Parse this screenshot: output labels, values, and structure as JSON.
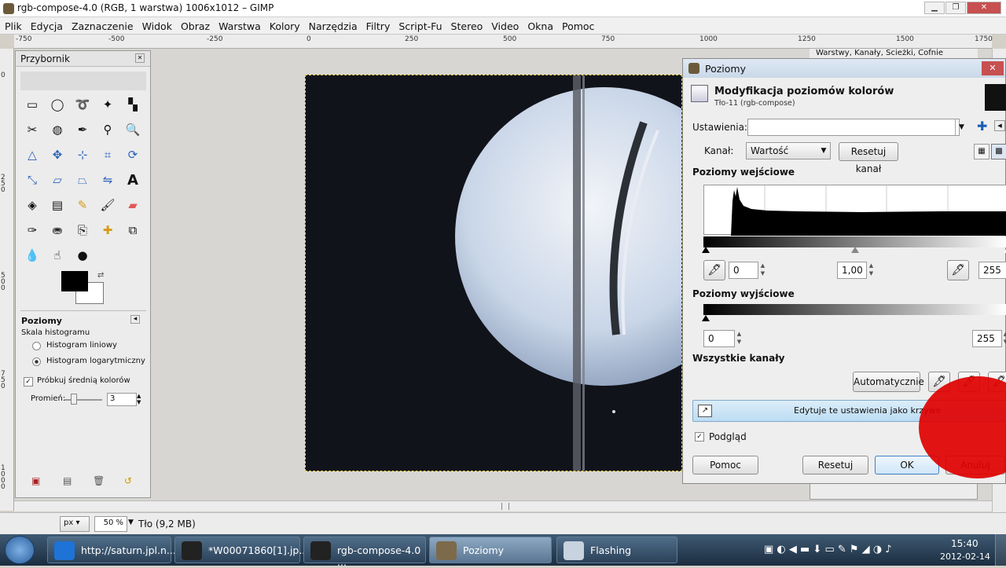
{
  "window": {
    "title": "rgb-compose-4.0 (RGB, 1 warstwa) 1006x1012 – GIMP"
  },
  "menu": [
    "Plik",
    "Edycja",
    "Zaznaczenie",
    "Widok",
    "Obraz",
    "Warstwa",
    "Kolory",
    "Narzędzia",
    "Filtry",
    "Script-Fu",
    "Stereo",
    "Video",
    "Okna",
    "Pomoc"
  ],
  "ruler": {
    "h_labels": [
      "-750",
      "-500",
      "-250",
      "0",
      "250",
      "500",
      "750",
      "1000",
      "1250",
      "1500",
      "1750"
    ],
    "v_labels": [
      "0",
      "250",
      "500",
      "750",
      "1000"
    ]
  },
  "layers_dock_text": "Warstwy, Kanały, Ścieżki, Cofnie",
  "toolbox": {
    "title": "Przybornik",
    "tool_icons": [
      "rect-select-icon",
      "ellipse-select-icon",
      "lasso-icon",
      "fuzzy-select-icon",
      "color-select-icon",
      "scissors-icon",
      "foreground-select-icon",
      "paths-icon",
      "color-picker-icon",
      "zoom-icon",
      "measure-icon",
      "move-icon",
      "align-icon",
      "crop-icon",
      "transform-icon",
      "scale-icon",
      "shear-icon",
      "perspective-icon",
      "flip-icon",
      "text-icon",
      "bucket-fill-icon",
      "blend-icon",
      "pencil-icon",
      "paintbrush-icon",
      "eraser-icon",
      "airbrush-icon",
      "ink-icon",
      "clone-icon",
      "heal-icon",
      "perspective-clone-icon",
      "blur-icon",
      "smudge-icon",
      "dodge-burn-icon"
    ],
    "options_title": "Poziomy",
    "scale_label": "Skala histogramu",
    "radio_linear": "Histogram liniowy",
    "radio_log": "Histogram logarytmiczny",
    "sample_average": "Próbkuj średnią kolorów",
    "radius_label": "Promień:",
    "radius_value": "3"
  },
  "levels_dialog": {
    "window_title": "Poziomy",
    "heading": "Modyfikacja poziomów kolorów",
    "subheading": "Tło-11 (rgb-compose)",
    "presets_label": "Ustawienia:",
    "presets_value": "",
    "channel_label": "Kanał:",
    "channel_value": "Wartość",
    "reset_channel": "Resetuj kanał",
    "input_levels_label": "Poziomy wejściowe",
    "input_low": "0",
    "input_gamma": "1,00",
    "input_high": "255",
    "output_levels_label": "Poziomy wyjściowe",
    "output_low": "0",
    "output_high": "255",
    "all_channels_label": "Wszystkie kanały",
    "auto_button": "Automatycznie",
    "edit_curves": "Edytuje te ustawienia jako krzywe",
    "preview_label": "Podgląd",
    "help_button": "Pomoc",
    "reset_button": "Resetuj",
    "ok_button": "OK",
    "cancel_button": "Anuluj"
  },
  "statusbar": {
    "unit": "px",
    "zoom": "50 %",
    "info": "Tło (9,2 MB)"
  },
  "taskbar": {
    "tasks": [
      "http://saturn.jpl.n...",
      "*W00071860[1].jp...",
      "rgb-compose-4.0 ...",
      "Poziomy",
      "Flashing"
    ],
    "time": "15:40",
    "date": "2012-02-14"
  },
  "colors": {
    "accent_blue": "#c9e3f5",
    "indicator_red": "#e00000",
    "canvas_bg": "#11131a"
  }
}
